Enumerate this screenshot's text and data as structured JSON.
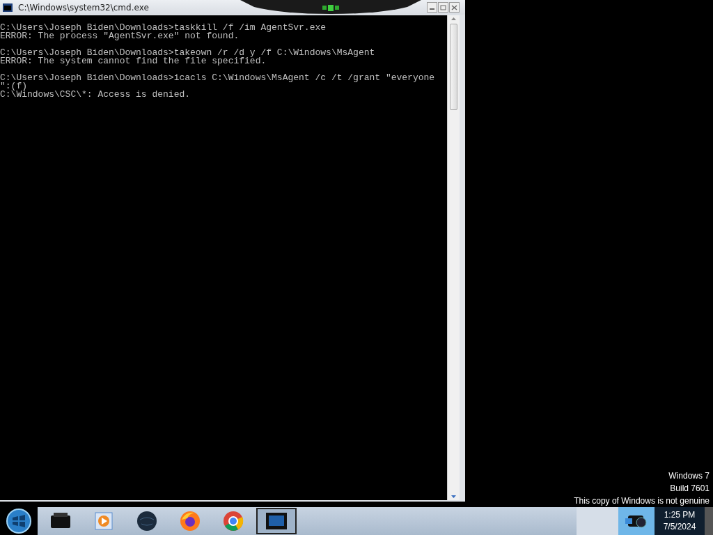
{
  "window": {
    "title": "C:\\Windows\\system32\\cmd.exe"
  },
  "console": {
    "blocks": [
      {
        "lines": [
          "C:\\Users\\Joseph Biden\\Downloads>taskkill /f /im AgentSvr.exe",
          "ERROR: The process \"AgentSvr.exe\" not found."
        ]
      },
      {
        "lines": [
          "C:\\Users\\Joseph Biden\\Downloads>takeown /r /d y /f C:\\Windows\\MsAgent",
          "ERROR: The system cannot find the file specified."
        ]
      },
      {
        "lines": [
          "C:\\Users\\Joseph Biden\\Downloads>icacls C:\\Windows\\MsAgent /c /t /grant \"everyone",
          "\":(f)",
          "C:\\Windows\\CSC\\*: Access is denied."
        ]
      }
    ]
  },
  "desktop": {
    "watermark": [
      "Windows 7",
      "Build 7601",
      "This copy of Windows is not genuine"
    ]
  },
  "taskbar": {
    "apps": [
      {
        "kind": "printer",
        "selected": false
      },
      {
        "kind": "media",
        "selected": false
      },
      {
        "kind": "globe",
        "selected": false
      },
      {
        "kind": "firefox",
        "selected": false
      },
      {
        "kind": "chrome",
        "selected": false
      },
      {
        "kind": "console",
        "selected": true
      }
    ],
    "clock": {
      "time": "1:25 PM",
      "date": "7/5/2024"
    }
  }
}
